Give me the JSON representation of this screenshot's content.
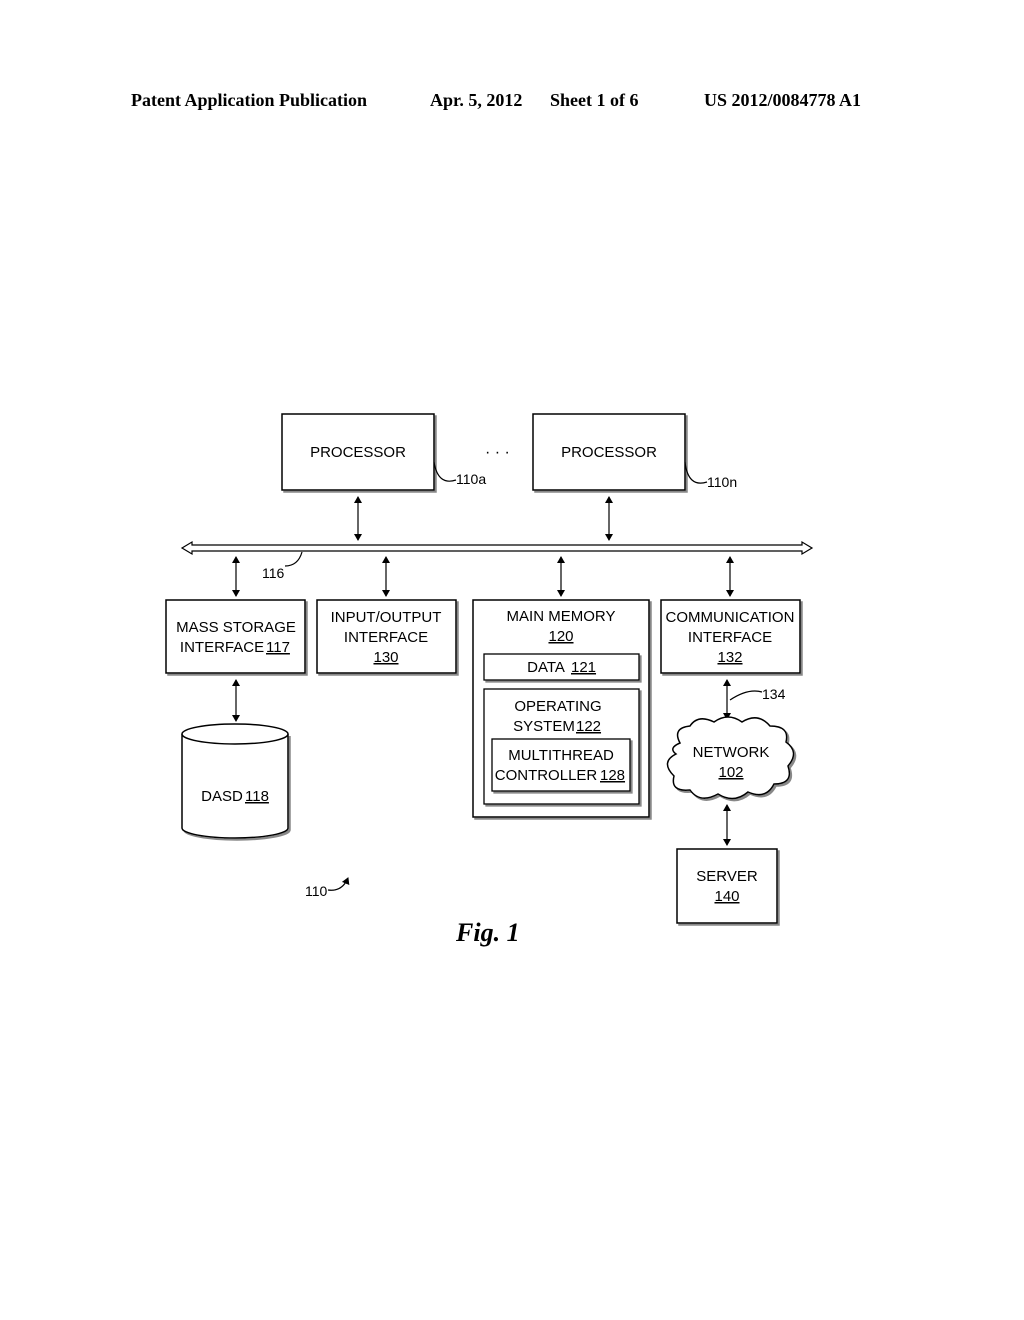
{
  "header": {
    "publication": "Patent Application Publication",
    "date": "Apr. 5, 2012",
    "sheet": "Sheet 1 of 6",
    "number": "US 2012/0084778 A1"
  },
  "diagram": {
    "processor_a": {
      "label": "PROCESSOR",
      "ref": "110a"
    },
    "processor_n": {
      "label": "PROCESSOR",
      "ref": "110n"
    },
    "ellipsis": "· · ·",
    "bus": {
      "ref": "116"
    },
    "mass_storage": {
      "line1": "MASS STORAGE",
      "line2": "INTERFACE",
      "ref": "117"
    },
    "io": {
      "line1": "INPUT/OUTPUT",
      "line2": "INTERFACE",
      "ref": "130"
    },
    "main_memory": {
      "line1": "MAIN MEMORY",
      "ref": "120"
    },
    "data": {
      "label": "DATA",
      "ref": "121"
    },
    "os": {
      "line1": "OPERATING",
      "line2": "SYSTEM",
      "ref": "122"
    },
    "multithread": {
      "line1": "MULTITHREAD",
      "line2": "CONTROLLER",
      "ref": "128"
    },
    "comm": {
      "line1": "COMMUNICATION",
      "line2": "INTERFACE",
      "ref": "132"
    },
    "network_link": {
      "ref": "134"
    },
    "network": {
      "label": "NETWORK",
      "ref": "102"
    },
    "server": {
      "label": "SERVER",
      "ref": "140"
    },
    "dasd": {
      "label": "DASD",
      "ref": "118"
    },
    "system": {
      "ref": "110"
    }
  },
  "figure_caption": "Fig. 1"
}
